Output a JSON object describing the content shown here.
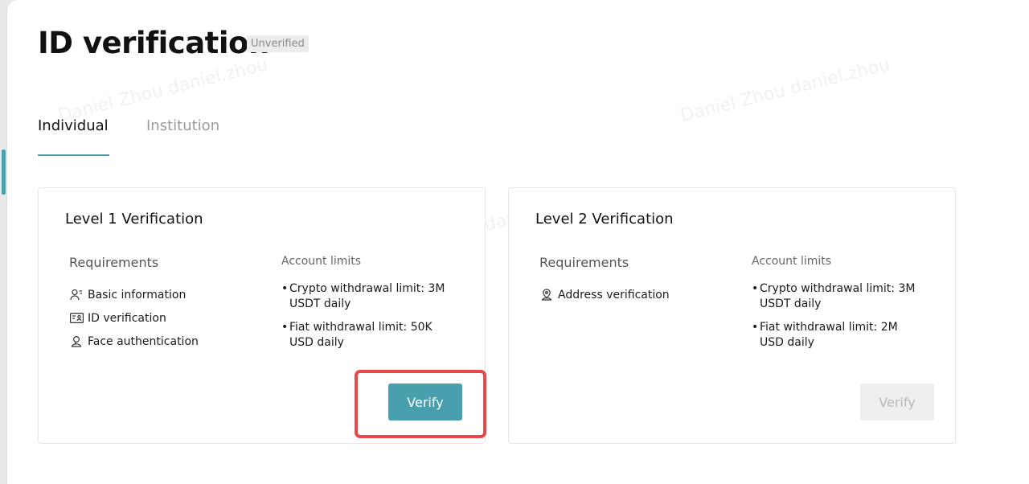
{
  "header": {
    "title": "ID verification",
    "status_badge": "Unverified"
  },
  "tabs": [
    {
      "label": "Individual",
      "active": true
    },
    {
      "label": "Institution",
      "active": false
    }
  ],
  "level1": {
    "title": "Level 1 Verification",
    "requirements_label": "Requirements",
    "requirements": [
      {
        "label": "Basic information",
        "icon": "user-info-icon"
      },
      {
        "label": "ID verification",
        "icon": "id-card-icon"
      },
      {
        "label": "Face authentication",
        "icon": "face-icon"
      }
    ],
    "limits_label": "Account limits",
    "limits": [
      "Crypto withdrawal limit: 3M USDT daily",
      "Fiat withdrawal limit: 50K USD daily"
    ],
    "button_label": "Verify",
    "button_enabled": true
  },
  "level2": {
    "title": "Level 2 Verification",
    "requirements_label": "Requirements",
    "requirements": [
      {
        "label": "Address verification",
        "icon": "location-icon"
      }
    ],
    "limits_label": "Account limits",
    "limits": [
      "Crypto withdrawal limit: 3M USDT daily",
      "Fiat withdrawal limit: 2M USD daily"
    ],
    "button_label": "Verify",
    "button_enabled": false
  },
  "watermark": {
    "text": "Daniel Zhou daniel.zhou"
  },
  "colors": {
    "accent": "#4a9fae",
    "highlight": "#e84848",
    "disabled_bg": "#efefef",
    "disabled_text": "#b8b8b8"
  }
}
